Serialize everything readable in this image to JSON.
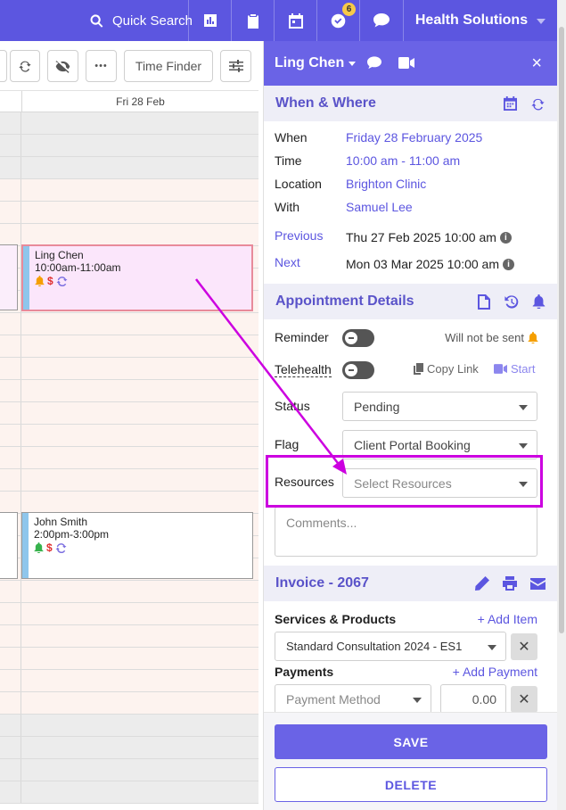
{
  "topbar": {
    "search_label": "Quick Search",
    "badge_count": "6",
    "org_name": "Health Solutions"
  },
  "toolbar": {
    "time_finder": "Time Finder",
    "more": "•••"
  },
  "calendar": {
    "day_header": "Fri 28 Feb",
    "appointments": [
      {
        "name": "Ling Chen",
        "time": "10:00am-11:00am"
      },
      {
        "name": "John Smith",
        "time": "2:00pm-3:00pm"
      }
    ]
  },
  "panel": {
    "client_name": "Ling Chen",
    "close": "×",
    "when_where": {
      "title": "When & Where",
      "when_label": "When",
      "when_value": "Friday 28 February 2025",
      "time_label": "Time",
      "time_value": "10:00 am - 11:00 am",
      "location_label": "Location",
      "location_value": "Brighton Clinic",
      "with_label": "With",
      "with_value": "Samuel Lee",
      "previous_label": "Previous",
      "previous_value": "Thu 27 Feb 2025 10:00 am",
      "next_label": "Next",
      "next_value": "Mon 03 Mar 2025 10:00 am",
      "info": "i"
    },
    "appointment_details": {
      "title": "Appointment Details",
      "reminder_label": "Reminder",
      "reminder_status": "Will not be sent",
      "telehealth_label": "Telehealth",
      "copy_link": "Copy Link",
      "start": "Start",
      "status_label": "Status",
      "status_value": "Pending",
      "flag_label": "Flag",
      "flag_value": "Client Portal Booking",
      "resources_label": "Resources",
      "resources_placeholder": "Select Resources",
      "comments_placeholder": "Comments..."
    },
    "invoice": {
      "title": "Invoice - 2067",
      "services_label": "Services & Products",
      "add_item": "+ Add Item",
      "service_value": "Standard Consultation 2024 - ES1",
      "payments_label": "Payments",
      "add_payment": "+ Add Payment",
      "payment_method_placeholder": "Payment Method",
      "payment_amount": "0.00",
      "remove": "✕"
    },
    "actions": {
      "save": "SAVE",
      "delete": "DELETE"
    }
  },
  "colors": {
    "brand": "#5c56e0",
    "highlight": "#cc00e0",
    "reminder_bell": "#f59f00",
    "billing_dollar": "#e03131"
  }
}
